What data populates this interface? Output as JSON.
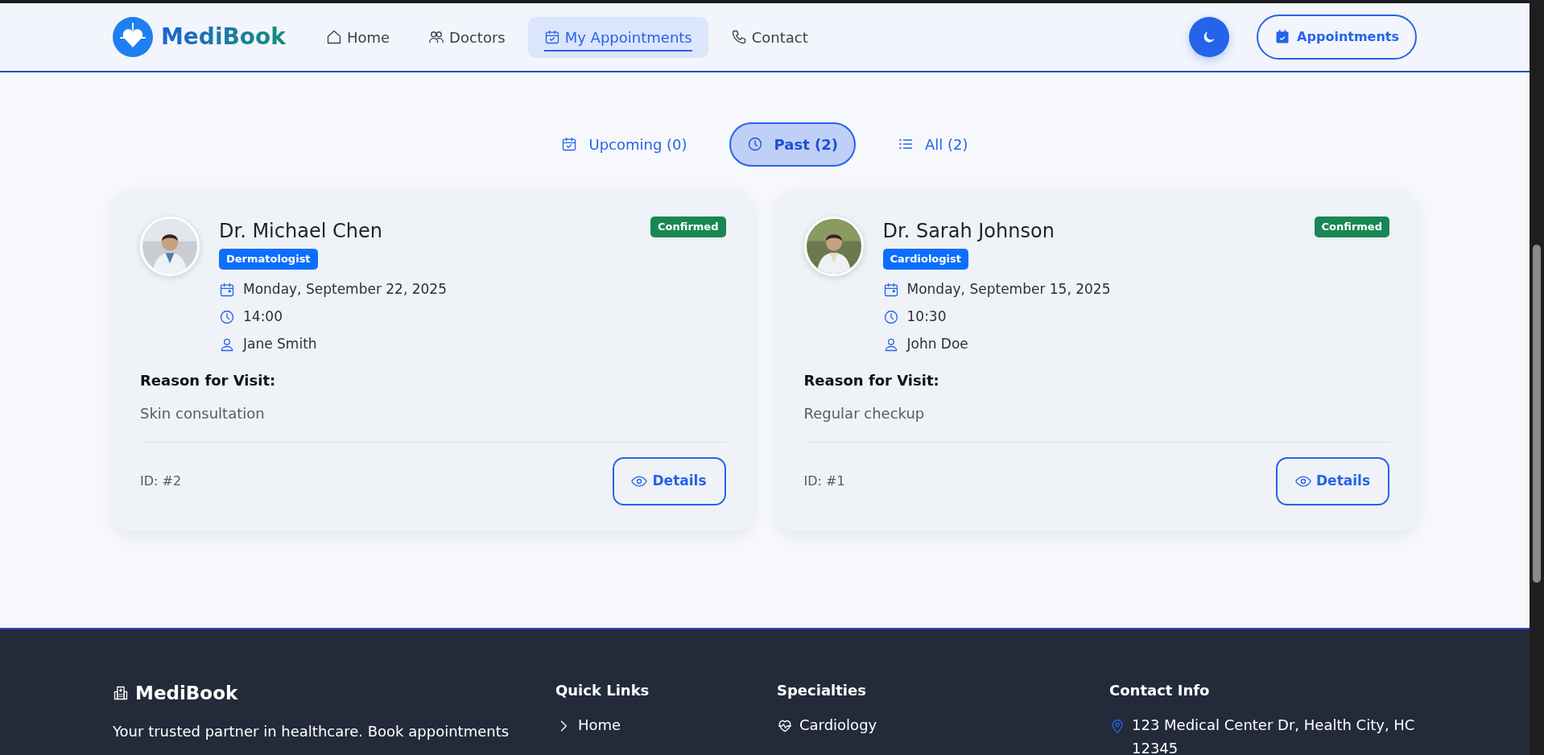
{
  "navbar": {
    "brand": "MediBook",
    "links": [
      {
        "label": "Home",
        "selected": false
      },
      {
        "label": "Doctors",
        "selected": false
      },
      {
        "label": "My Appointments",
        "selected": true
      },
      {
        "label": "Contact",
        "selected": false
      }
    ],
    "cta": "Appointments"
  },
  "tabs": [
    {
      "label": "Upcoming (0)",
      "selected": false
    },
    {
      "label": "Past (2)",
      "selected": true
    },
    {
      "label": "All (2)",
      "selected": false
    }
  ],
  "appointments": [
    {
      "doctor": "Dr. Michael Chen",
      "specialty": "Dermatologist",
      "status": "Confirmed",
      "color": "#198754",
      "date": "Monday, September 22, 2025",
      "time": "14:00",
      "patient": "Jane Smith",
      "reason_label": "Reason for Visit:",
      "reason": "Skin consultation",
      "id": "ID: #2",
      "button": "Details"
    },
    {
      "doctor": "Dr. Sarah Johnson",
      "specialty": "Cardiologist",
      "status": "Confirmed",
      "color": "#198754",
      "date": "Monday, September 15, 2025",
      "time": "10:30",
      "patient": "John Doe",
      "reason_label": "Reason for Visit:",
      "reason": "Regular checkup",
      "id": "ID: #1",
      "button": "Details"
    }
  ],
  "footer": {
    "brand": "MediBook",
    "description": "Your trusted partner in healthcare. Book appointments",
    "quick_links": {
      "title": "Quick Links",
      "items": [
        "Home"
      ]
    },
    "specialties": {
      "title": "Specialties",
      "items": [
        "Cardiology"
      ]
    },
    "contact": {
      "title": "Contact Info",
      "items": [
        "123 Medical Center Dr, Health City, HC 12345"
      ]
    }
  }
}
